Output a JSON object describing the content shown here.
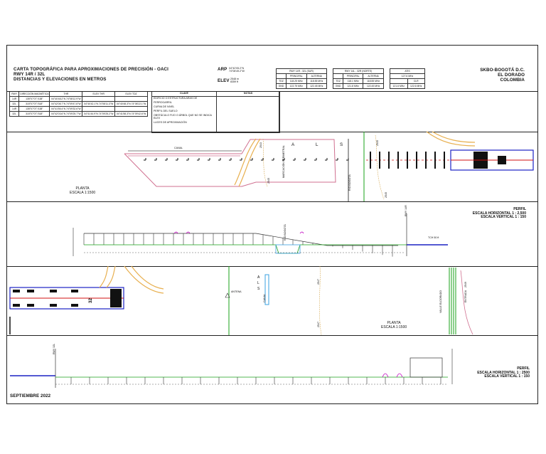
{
  "header": {
    "title_lines": [
      "CARTA TOPOGRÁFICA PARA APROXIMACIONES DE PRECISIÓN - OACI",
      "RWY 14R / 32L",
      "DISTANCIAS Y ELEVACIONES EN METROS"
    ],
    "arp_label": "ARP",
    "arp_coords": [
      "04°42'05.2''N",
      "74°08'49.2''W"
    ],
    "elev_label": "ELEV",
    "elev_values": [
      "2548 m",
      "8359 ft"
    ],
    "rwy_tables": [
      {
        "title": "RWY 14R - 32L (SUR)",
        "cols": [
          "PRINCIPAL",
          "ALTERNA"
        ],
        "rows": [
          [
            "TDZ",
            "118.25 MHz",
            "118.55 MHz"
          ],
          [
            "GND",
            "122.75 MHz",
            "122.45 MHz"
          ]
        ]
      },
      {
        "title": "RWY 14L - 32R (NORTE)",
        "cols": [
          "PRINCIPAL",
          "ALTERNA"
        ],
        "rows": [
          [
            "TDZ",
            "118.1 MHz",
            "118.55 MHz"
          ],
          [
            "GND",
            "121.8 MHz",
            "122.45 MHz"
          ]
        ]
      },
      {
        "title": "ATIS",
        "cols": [
          "127.6 MHz"
        ],
        "rows": [
          [
            "",
            "CLR"
          ],
          [
            "121.6 MHz",
            "122.6 MHz"
          ]
        ]
      }
    ],
    "location": [
      "SKBO-BOGOTÁ D.C.",
      "EL DORADO",
      "COLOMBIA"
    ]
  },
  "data_table": {
    "headers": [
      "RWY",
      "DIRECCIÓN MAGNÉTICA",
      "THR",
      "ELEV THR",
      "ELEV TDZ"
    ],
    "rows": [
      [
        "14R",
        "135°07'07''/138°",
        "04°40'48.2''N 74°08'12.9''W",
        "",
        ""
      ],
      [
        "32L",
        "315°07'07''/318°",
        "04°42'08.7''N 74°09'47.8''W",
        "04°40'42.1''N 74°08'11.3''W",
        "04°40'48.3''N 74°08'22.1''W"
      ],
      [
        "14R",
        "135°07'07''/138°",
        "04°41'55.4''N 74°09'32.6''W",
        "",
        ""
      ],
      [
        "32L",
        "315°07'07''/318°",
        "04°42'03.6''N 74°09'25.7''W",
        "04°41'44.9''N 74°09'25.2''W",
        "04°41'58.3''N 74°09'42.6''W"
      ]
    ]
  },
  "legend": {
    "title": "CLAVE",
    "items": [
      "EDIFICIO O ESTRUCTURA ARAS DE",
      "FERROCARRIL",
      "CURVA DE NIVEL",
      "PERFIL DEL SUELO",
      "OBSTÁCULO FIJO O ÁRBOL QUE NO SE INDICA ELEV",
      "LUCES DE APROXIMACIÓN"
    ],
    "notes_title": "NOTAS"
  },
  "plan1": {
    "canal_label": "CANAL",
    "letters": [
      "A",
      "L",
      "S"
    ],
    "marker_label": "MARCACIÓN PERIMETRAL",
    "road_label": "RÍO BOGOTÁ",
    "contour_labels": [
      "2543",
      "2545",
      "2545",
      "2545"
    ],
    "plan_label": "PLANTA",
    "scale_label": "ESCALA 1:1500"
  },
  "profile1": {
    "title": "PERFIL",
    "scales": [
      "ESCALA HORIZONTAL 1 : 2,500",
      "ESCALA VERTICAL 1 : 150"
    ],
    "tch_label": "TCH 50 ft",
    "rwy_label": "RWY 14R",
    "river_label": "RÍO BOGOTÁ"
  },
  "plan2": {
    "canal_label": "CANAL",
    "letters": [
      "A",
      "L",
      "S"
    ],
    "antenna_label": "ANTENA",
    "valle_label": "VALLE ELDORADO",
    "entry_label": "ENTRADA",
    "contour_labels": [
      "2547",
      "2547",
      "2549"
    ],
    "plan_label": "PLANTA",
    "scale_label": "ESCALA 1:1500",
    "runway_number": "32"
  },
  "profile2": {
    "title": "PERFIL",
    "scales": [
      "ESCALA HORIZONTAL 1 : 2500",
      "ESCALA VERTICAL 1 : 150"
    ],
    "rwy_label": "RWY 32L"
  },
  "footer": {
    "date": "SEPTIEMBRE 2022"
  },
  "colors": {
    "ground": "#1aa11a",
    "runway_center": "#d01010",
    "runway_edge": "#1c22c4",
    "boundary": "#d07090",
    "canal": "#3aa0e0",
    "road": "#e8b050",
    "markers": "#c000c0",
    "contour": "#d8b060"
  }
}
